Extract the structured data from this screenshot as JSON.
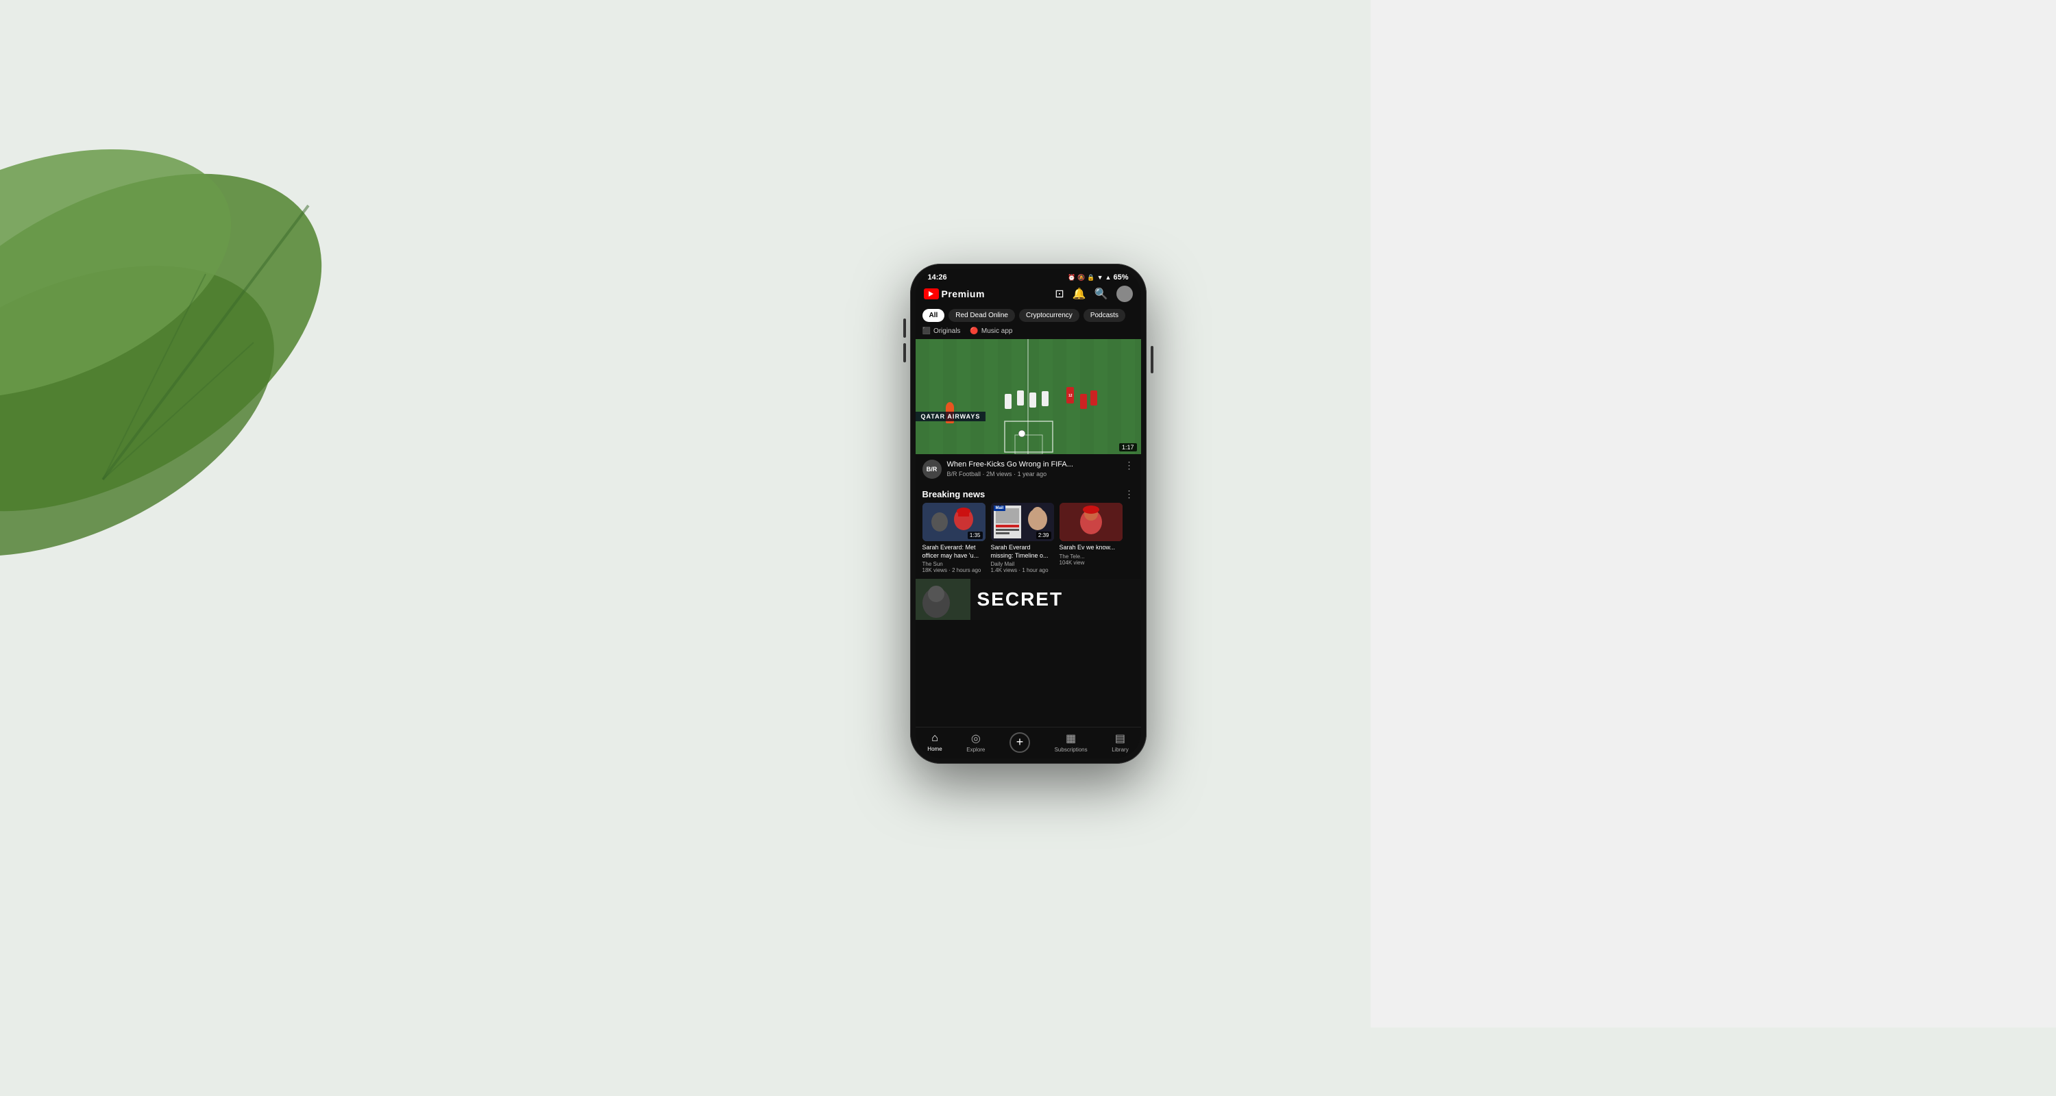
{
  "background": {
    "leaf_color": "#4a7a3a",
    "right_color": "#f5f5f5"
  },
  "status_bar": {
    "time": "14:26",
    "battery": "65%"
  },
  "header": {
    "logo_text": "Premium",
    "cast_icon": "cast-icon",
    "bell_icon": "bell-icon",
    "search_icon": "search-icon",
    "avatar_icon": "avatar-icon"
  },
  "filter_chips": [
    {
      "label": "All",
      "active": true
    },
    {
      "label": "Red Dead Online",
      "active": false
    },
    {
      "label": "Cryptocurrency",
      "active": false
    },
    {
      "label": "Podcasts",
      "active": false
    }
  ],
  "premium_row": [
    {
      "label": "Originals",
      "icon": "originals-icon"
    },
    {
      "label": "Music app",
      "icon": "music-icon"
    }
  ],
  "main_video": {
    "title": "When Free-Kicks Go Wrong in FIFA...",
    "channel": "B/R Football",
    "views": "2M views",
    "age": "1 year ago",
    "duration": "1:17",
    "banner": "QATAR AIRWAYS"
  },
  "breaking_news": {
    "section_title": "Breaking news",
    "videos": [
      {
        "title": "Sarah Everard: Met officer may have 'u...",
        "channel": "The Sun",
        "views": "18K views",
        "age": "2 hours ago",
        "duration": "1:35",
        "thumb_style": "sun"
      },
      {
        "title": "Sarah Everard missing: Timeline o...",
        "channel": "Daily Mail",
        "views": "1.4K views",
        "age": "1 hour ago",
        "duration": "2:39",
        "thumb_style": "mail",
        "label": "MISSING"
      },
      {
        "title": "Sarah Ev we know...",
        "channel": "The Tele...",
        "views": "104K view",
        "age": "",
        "duration": "",
        "thumb_style": "red"
      }
    ]
  },
  "secret_section": {
    "text": "SECRET"
  },
  "bottom_nav": [
    {
      "label": "Home",
      "icon": "home-icon",
      "active": true
    },
    {
      "label": "Explore",
      "icon": "compass-icon",
      "active": false
    },
    {
      "label": "+",
      "icon": "add-icon",
      "active": false
    },
    {
      "label": "Subscriptions",
      "icon": "subscriptions-icon",
      "active": false
    },
    {
      "label": "Library",
      "icon": "library-icon",
      "active": false
    }
  ]
}
